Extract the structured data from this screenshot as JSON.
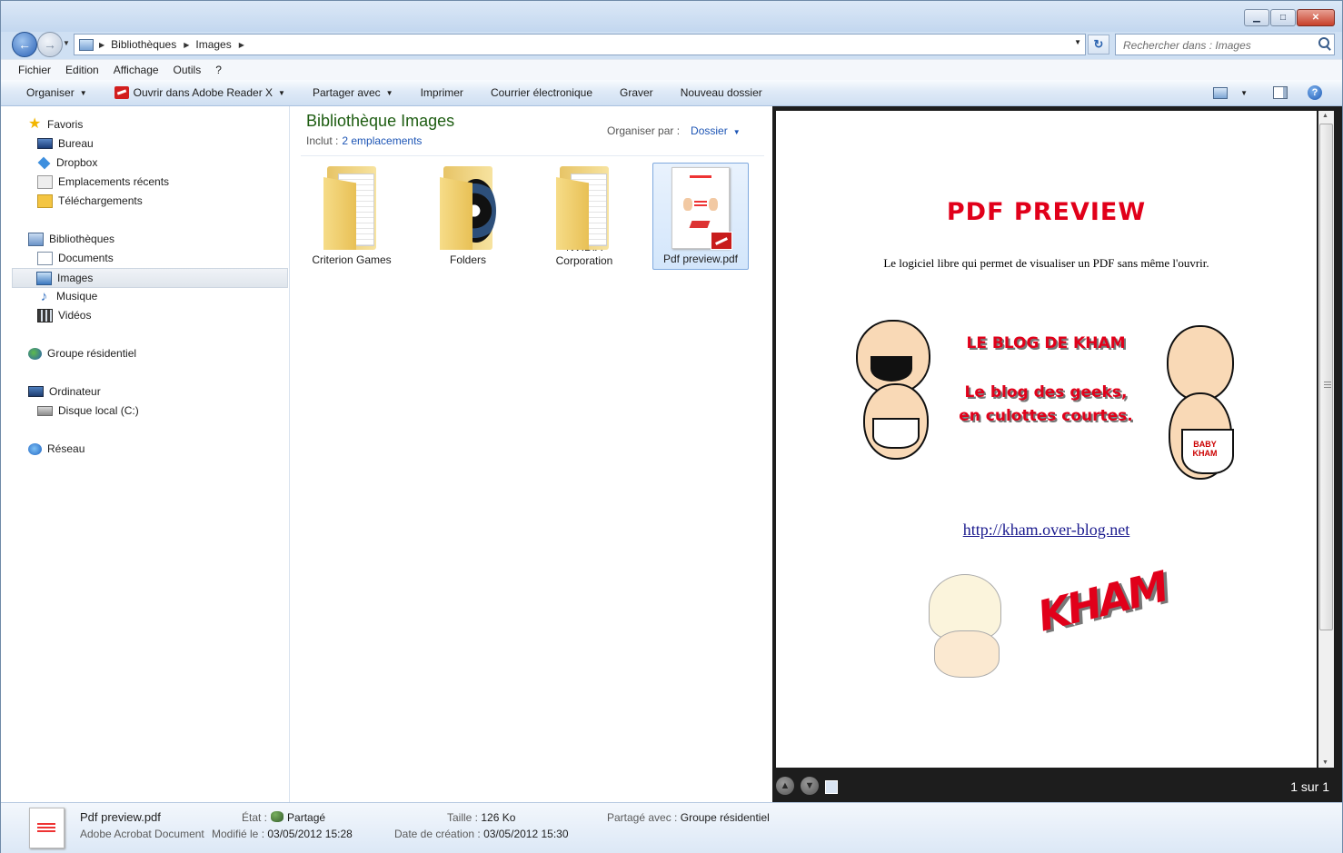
{
  "address": {
    "crumbs": [
      "Bibliothèques",
      "Images"
    ]
  },
  "search": {
    "placeholder": "Rechercher dans : Images"
  },
  "menu": [
    "Fichier",
    "Edition",
    "Affichage",
    "Outils",
    "?"
  ],
  "toolbar": {
    "organise": "Organiser",
    "open_with": "Ouvrir dans Adobe Reader X",
    "share": "Partager avec",
    "print": "Imprimer",
    "email": "Courrier électronique",
    "burn": "Graver",
    "new_folder": "Nouveau dossier"
  },
  "nav": {
    "favorites": "Favoris",
    "bureau": "Bureau",
    "dropbox": "Dropbox",
    "recent": "Emplacements récents",
    "downloads": "Téléchargements",
    "libraries": "Bibliothèques",
    "documents": "Documents",
    "images": "Images",
    "music": "Musique",
    "videos": "Vidéos",
    "homegroup": "Groupe résidentiel",
    "computer": "Ordinateur",
    "local_disk": "Disque local (C:)",
    "network": "Réseau"
  },
  "library": {
    "title": "Bibliothèque Images",
    "includes_label": "Inclut :",
    "includes_link": "2 emplacements",
    "arrange_label": "Organiser par :",
    "arrange_value": "Dossier"
  },
  "items": [
    {
      "label": "Criterion Games",
      "type": "folder"
    },
    {
      "label": "Folders",
      "type": "folder"
    },
    {
      "label": "NVIDIA Corporation",
      "type": "folder"
    },
    {
      "label": "Pdf preview.pdf",
      "type": "pdf",
      "selected": true
    }
  ],
  "preview": {
    "pdf_title": "PDF PREVIEW",
    "pdf_subtitle": "Le logiciel libre qui permet de visualiser un PDF sans même l'ouvrir.",
    "blog_line1": "LE BLOG DE KHAM",
    "blog_line2": "Le blog des geeks,",
    "blog_line3": "en culottes courtes.",
    "diaper_text": "BABY KHAM",
    "link": "http://kham.over-blog.net",
    "logo": "KHAM",
    "page_count": "1 sur 1"
  },
  "details": {
    "name": "Pdf preview.pdf",
    "type": "Adobe Acrobat Document",
    "state_label": "État :",
    "state_value": "Partagé",
    "modified_label": "Modifié le :",
    "modified_value": "03/05/2012 15:28",
    "size_label": "Taille :",
    "size_value": "126 Ko",
    "created_label": "Date de création :",
    "created_value": "03/05/2012 15:30",
    "shared_label": "Partagé avec :",
    "shared_value": "Groupe résidentiel"
  },
  "colors": {
    "library_title": "#1e5d12",
    "link_blue": "#1d55b5",
    "pdf_red": "#e1001a"
  }
}
